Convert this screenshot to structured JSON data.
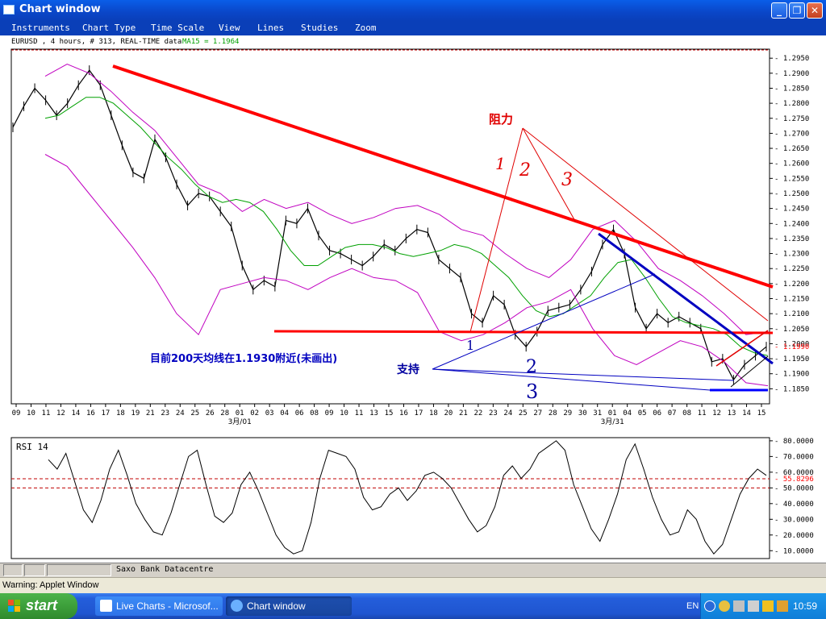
{
  "window": {
    "title": "Chart window"
  },
  "menu": [
    "Instruments",
    "Chart Type",
    "Time Scale",
    "View",
    "Lines",
    "Studies",
    "Zoom"
  ],
  "info": {
    "left": "EURUSD , 4 hours, # 313, REAL-TIME data",
    "ma": "MA15 = 1.1964"
  },
  "chart_data": [
    {
      "type": "line",
      "instrument": "EURUSD",
      "y_ticks": [
        "1.2950",
        "1.2900",
        "1.2850",
        "1.2800",
        "1.2750",
        "1.2700",
        "1.2650",
        "1.2600",
        "1.2550",
        "1.2500",
        "1.2450",
        "1.2400",
        "1.2350",
        "1.2300",
        "1.2250",
        "1.2200",
        "1.2150",
        "1.2100",
        "1.2050",
        "1.2000",
        "1.1950",
        "1.1900",
        "1.1850"
      ],
      "ylim": [
        1.18,
        1.298
      ],
      "x_ticks": [
        "09",
        "10",
        "11",
        "12",
        "14",
        "16",
        "17",
        "18",
        "19",
        "21",
        "23",
        "24",
        "25",
        "26",
        "28",
        "01",
        "02",
        "03",
        "04",
        "06",
        "08",
        "09",
        "10",
        "11",
        "13",
        "15",
        "16",
        "17",
        "18",
        "20",
        "21",
        "22",
        "23",
        "24",
        "25",
        "27",
        "28",
        "29",
        "30",
        "31",
        "01",
        "04",
        "05",
        "06",
        "07",
        "08",
        "11",
        "12",
        "13",
        "14",
        "15"
      ],
      "month_labels": [
        "3月/01",
        "3月/31"
      ],
      "last_price": "1.1990",
      "series": [
        {
          "name": "price",
          "color": "#000000",
          "values": [
            1.272,
            1.279,
            1.285,
            1.281,
            1.276,
            1.28,
            1.286,
            1.291,
            1.286,
            1.276,
            1.266,
            1.257,
            1.255,
            1.268,
            1.262,
            1.253,
            1.246,
            1.25,
            1.249,
            1.244,
            1.239,
            1.226,
            1.218,
            1.221,
            1.219,
            1.241,
            1.24,
            1.245,
            1.236,
            1.231,
            1.23,
            1.228,
            1.226,
            1.229,
            1.233,
            1.231,
            1.235,
            1.238,
            1.237,
            1.228,
            1.225,
            1.222,
            1.21,
            1.207,
            1.216,
            1.213,
            1.203,
            1.199,
            1.204,
            1.211,
            1.212,
            1.213,
            1.218,
            1.224,
            1.233,
            1.238,
            1.23,
            1.212,
            1.205,
            1.21,
            1.207,
            1.209,
            1.207,
            1.205,
            1.194,
            1.195,
            1.188,
            1.193,
            1.196,
            1.199
          ]
        },
        {
          "name": "MA15",
          "color": "#00a000",
          "values": [
            1.275,
            1.276,
            1.279,
            1.282,
            1.282,
            1.28,
            1.276,
            1.272,
            1.267,
            1.262,
            1.258,
            1.253,
            1.249,
            1.247,
            1.248,
            1.247,
            1.244,
            1.238,
            1.231,
            1.226,
            1.226,
            1.229,
            1.232,
            1.233,
            1.233,
            1.232,
            1.23,
            1.229,
            1.23,
            1.231,
            1.233,
            1.232,
            1.23,
            1.226,
            1.222,
            1.216,
            1.211,
            1.209,
            1.21,
            1.213,
            1.216,
            1.222,
            1.227,
            1.228,
            1.222,
            1.215,
            1.209,
            1.207,
            1.206,
            1.205,
            1.203,
            1.199,
            1.197,
            1.196
          ]
        },
        {
          "name": "BB-upper",
          "color": "#c000c0",
          "values": [
            1.289,
            1.293,
            1.29,
            1.284,
            1.277,
            1.271,
            1.262,
            1.253,
            1.25,
            1.244,
            1.248,
            1.245,
            1.247,
            1.243,
            1.24,
            1.242,
            1.245,
            1.246,
            1.243,
            1.238,
            1.236,
            1.23,
            1.225,
            1.222,
            1.228,
            1.238,
            1.241,
            1.234,
            1.225,
            1.221,
            1.216,
            1.21,
            1.203,
            1.204
          ]
        },
        {
          "name": "BB-lower",
          "color": "#c000c0",
          "values": [
            1.263,
            1.259,
            1.25,
            1.241,
            1.232,
            1.222,
            1.21,
            1.203,
            1.218,
            1.22,
            1.222,
            1.221,
            1.218,
            1.222,
            1.225,
            1.222,
            1.221,
            1.217,
            1.204,
            1.201,
            1.203,
            1.207,
            1.212,
            1.214,
            1.218,
            1.205,
            1.196,
            1.193,
            1.197,
            1.201,
            1.199,
            1.194,
            1.187,
            1.186
          ]
        }
      ],
      "annotations": {
        "resistance_label": "阻力",
        "support_label": "支持",
        "note": "目前200天均线在1.1930附近(未画出)",
        "resistance_numbers": [
          "1",
          "2",
          "3"
        ],
        "support_numbers": [
          "1",
          "2",
          "3"
        ]
      }
    },
    {
      "type": "line",
      "title": "RSI 14",
      "y_ticks": [
        "80.0000",
        "70.0000",
        "60.0000",
        "50.0000",
        "40.0000",
        "30.0000",
        "20.0000",
        "10.0000"
      ],
      "ylim": [
        5,
        82
      ],
      "current_value": "55.8296",
      "levels": [
        55.8296,
        50
      ],
      "series": [
        {
          "name": "RSI 14",
          "color": "#000000",
          "values": [
            68,
            62,
            72,
            54,
            36,
            28,
            42,
            62,
            74,
            58,
            40,
            30,
            22,
            20,
            34,
            52,
            70,
            74,
            52,
            32,
            28,
            34,
            52,
            60,
            48,
            34,
            20,
            12,
            8,
            10,
            28,
            56,
            74,
            72,
            70,
            62,
            44,
            36,
            38,
            46,
            50,
            42,
            48,
            58,
            60,
            56,
            50,
            40,
            30,
            22,
            26,
            38,
            58,
            64,
            56,
            62,
            72,
            76,
            80,
            74,
            52,
            38,
            24,
            16,
            30,
            46,
            68,
            78,
            62,
            44,
            30,
            20,
            22,
            36,
            30,
            16,
            8,
            14,
            30,
            46,
            56,
            62,
            58
          ]
        }
      ]
    }
  ],
  "status": {
    "source": "Saxo Bank Datacentre"
  },
  "warning": "Warning: Applet Window",
  "taskbar": {
    "start": "start",
    "items": [
      "Live Charts - Microsof...",
      "Chart window"
    ],
    "lang": "EN",
    "clock": "10:59"
  }
}
